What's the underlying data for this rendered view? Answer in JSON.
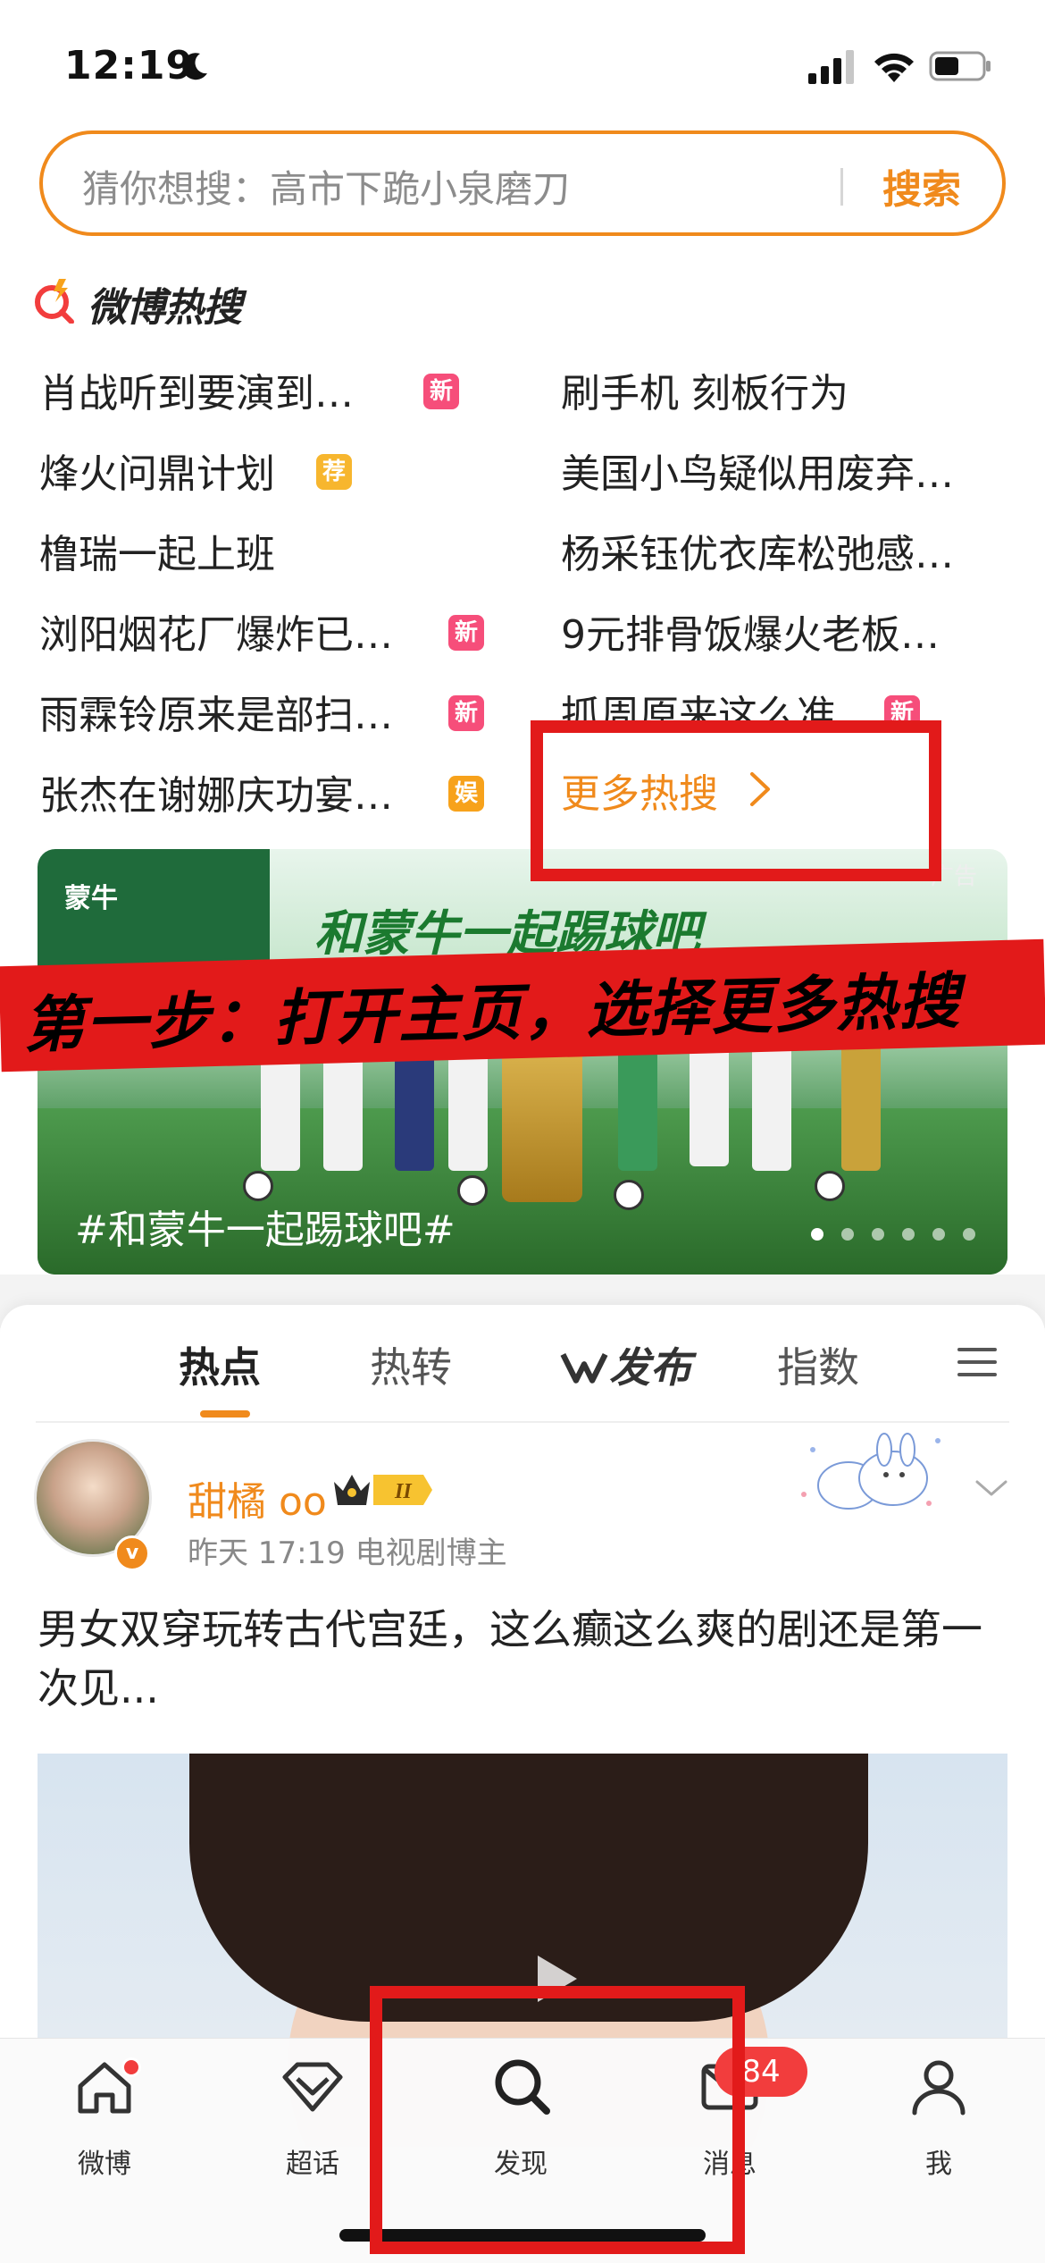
{
  "status_bar": {
    "time": "12:19",
    "icons": [
      "moon-icon",
      "signal-icon",
      "wifi-icon",
      "battery-icon"
    ]
  },
  "search": {
    "placeholder": "猜你想搜：高市下跪小泉磨刀",
    "button_label": "搜索"
  },
  "hot_search": {
    "title": "微博热搜",
    "items": [
      {
        "text": "肖战听到要演到…",
        "badge": "新",
        "badge_color": "#f64e7a"
      },
      {
        "text": "刷手机 刻板行为",
        "badge": "",
        "badge_color": ""
      },
      {
        "text": "烽火问鼎计划",
        "badge": "荐",
        "badge_color": "#f7b62e"
      },
      {
        "text": "美国小鸟疑似用废弃…",
        "badge": "",
        "badge_color": ""
      },
      {
        "text": "橹瑞一起上班",
        "badge": "",
        "badge_color": ""
      },
      {
        "text": "杨采钰优衣库松弛感…",
        "badge": "",
        "badge_color": ""
      },
      {
        "text": "浏阳烟花厂爆炸已…",
        "badge": "新",
        "badge_color": "#f64e7a"
      },
      {
        "text": "9元排骨饭爆火老板…",
        "badge": "",
        "badge_color": ""
      },
      {
        "text": "雨霖铃原来是部扫…",
        "badge": "新",
        "badge_color": "#f64e7a"
      },
      {
        "text": "抓周原来这么准",
        "badge": "新",
        "badge_color": "#f64e7a"
      },
      {
        "text": "张杰在谢娜庆功宴…",
        "badge": "娱",
        "badge_color": "#f7a21b"
      }
    ],
    "more_label": "更多热搜"
  },
  "banner": {
    "logo": "蒙牛",
    "headline": "和蒙牛一起踢球吧",
    "ad_label": "广告",
    "hashtag": "#和蒙牛一起踢球吧#",
    "page_count": 6,
    "active_index": 0
  },
  "instruction": "第一步：打开主页，选择更多热搜",
  "feed_tabs": [
    {
      "label": "热点",
      "active": true
    },
    {
      "label": "热转",
      "active": false
    },
    {
      "label": "发布",
      "active": false
    },
    {
      "label": "指数",
      "active": false
    }
  ],
  "post": {
    "author": "甜橘 oo",
    "level": "II",
    "verified": "v",
    "meta": "昨天 17:19  电视剧博主",
    "text": "男女双穿玩转古代宫廷，这么癫这么爽的剧还是第一次见..."
  },
  "tab_bar": {
    "items": [
      {
        "label": "微博",
        "icon": "home-icon"
      },
      {
        "label": "超话",
        "icon": "diamond-icon"
      },
      {
        "label": "发现",
        "icon": "search-icon"
      },
      {
        "label": "消息",
        "icon": "message-icon"
      },
      {
        "label": "我",
        "icon": "profile-icon"
      }
    ],
    "message_badge": "84"
  },
  "colors": {
    "accent": "#f08a1c",
    "highlight": "#e21a1a"
  }
}
